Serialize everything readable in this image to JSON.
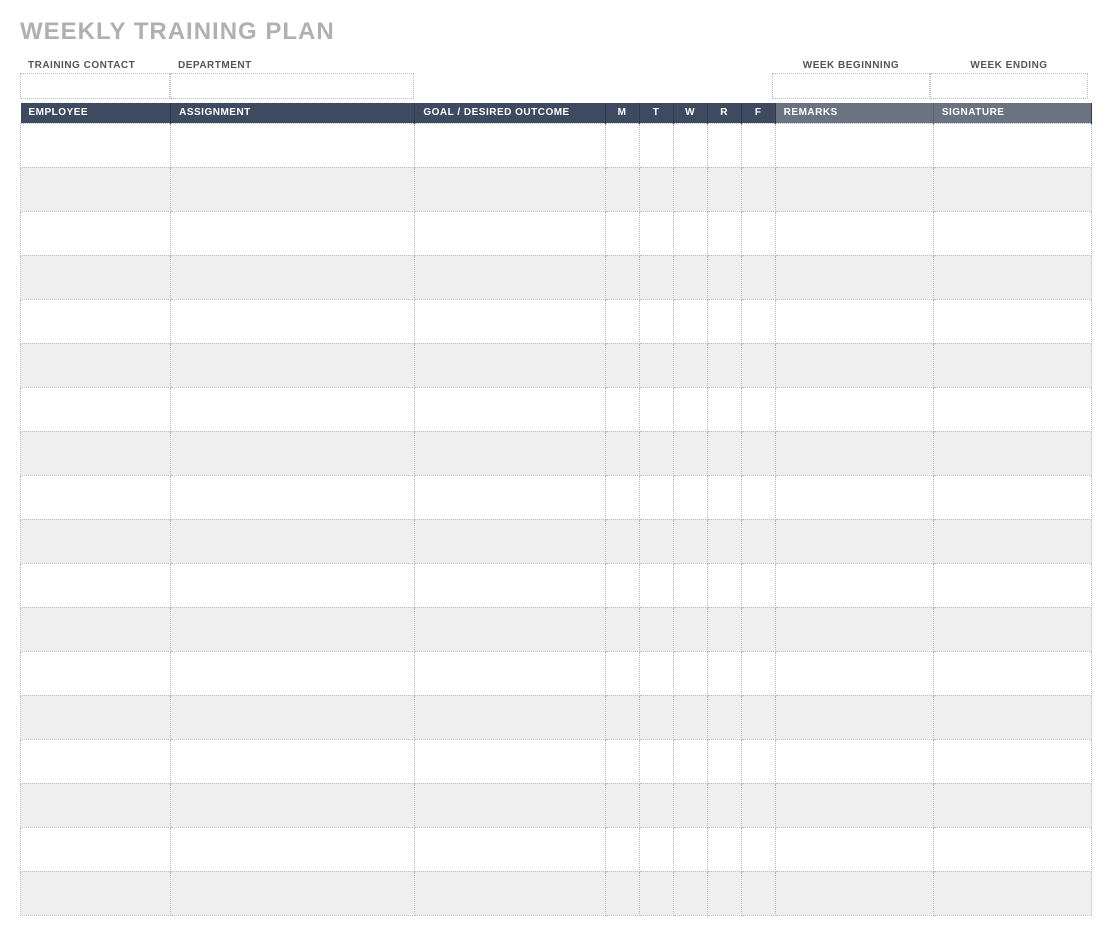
{
  "title": "WEEKLY TRAINING PLAN",
  "meta": {
    "training_contact_label": "TRAINING CONTACT",
    "department_label": "DEPARTMENT",
    "week_beginning_label": "WEEK BEGINNING",
    "week_ending_label": "WEEK ENDING",
    "training_contact": "",
    "department": "",
    "week_beginning": "",
    "week_ending": ""
  },
  "columns": {
    "employee": "EMPLOYEE",
    "assignment": "ASSIGNMENT",
    "goal": "GOAL / DESIRED OUTCOME",
    "m": "M",
    "t": "T",
    "w": "W",
    "r": "R",
    "f": "F",
    "remarks": "REMARKS",
    "signature": "SIGNATURE"
  },
  "rows": [
    {
      "employee": "",
      "assignment": "",
      "goal": "",
      "m": "",
      "t": "",
      "w": "",
      "r": "",
      "f": "",
      "remarks": "",
      "signature": ""
    },
    {
      "employee": "",
      "assignment": "",
      "goal": "",
      "m": "",
      "t": "",
      "w": "",
      "r": "",
      "f": "",
      "remarks": "",
      "signature": ""
    },
    {
      "employee": "",
      "assignment": "",
      "goal": "",
      "m": "",
      "t": "",
      "w": "",
      "r": "",
      "f": "",
      "remarks": "",
      "signature": ""
    },
    {
      "employee": "",
      "assignment": "",
      "goal": "",
      "m": "",
      "t": "",
      "w": "",
      "r": "",
      "f": "",
      "remarks": "",
      "signature": ""
    },
    {
      "employee": "",
      "assignment": "",
      "goal": "",
      "m": "",
      "t": "",
      "w": "",
      "r": "",
      "f": "",
      "remarks": "",
      "signature": ""
    },
    {
      "employee": "",
      "assignment": "",
      "goal": "",
      "m": "",
      "t": "",
      "w": "",
      "r": "",
      "f": "",
      "remarks": "",
      "signature": ""
    },
    {
      "employee": "",
      "assignment": "",
      "goal": "",
      "m": "",
      "t": "",
      "w": "",
      "r": "",
      "f": "",
      "remarks": "",
      "signature": ""
    },
    {
      "employee": "",
      "assignment": "",
      "goal": "",
      "m": "",
      "t": "",
      "w": "",
      "r": "",
      "f": "",
      "remarks": "",
      "signature": ""
    },
    {
      "employee": "",
      "assignment": "",
      "goal": "",
      "m": "",
      "t": "",
      "w": "",
      "r": "",
      "f": "",
      "remarks": "",
      "signature": ""
    },
    {
      "employee": "",
      "assignment": "",
      "goal": "",
      "m": "",
      "t": "",
      "w": "",
      "r": "",
      "f": "",
      "remarks": "",
      "signature": ""
    },
    {
      "employee": "",
      "assignment": "",
      "goal": "",
      "m": "",
      "t": "",
      "w": "",
      "r": "",
      "f": "",
      "remarks": "",
      "signature": ""
    },
    {
      "employee": "",
      "assignment": "",
      "goal": "",
      "m": "",
      "t": "",
      "w": "",
      "r": "",
      "f": "",
      "remarks": "",
      "signature": ""
    },
    {
      "employee": "",
      "assignment": "",
      "goal": "",
      "m": "",
      "t": "",
      "w": "",
      "r": "",
      "f": "",
      "remarks": "",
      "signature": ""
    },
    {
      "employee": "",
      "assignment": "",
      "goal": "",
      "m": "",
      "t": "",
      "w": "",
      "r": "",
      "f": "",
      "remarks": "",
      "signature": ""
    },
    {
      "employee": "",
      "assignment": "",
      "goal": "",
      "m": "",
      "t": "",
      "w": "",
      "r": "",
      "f": "",
      "remarks": "",
      "signature": ""
    },
    {
      "employee": "",
      "assignment": "",
      "goal": "",
      "m": "",
      "t": "",
      "w": "",
      "r": "",
      "f": "",
      "remarks": "",
      "signature": ""
    },
    {
      "employee": "",
      "assignment": "",
      "goal": "",
      "m": "",
      "t": "",
      "w": "",
      "r": "",
      "f": "",
      "remarks": "",
      "signature": ""
    },
    {
      "employee": "",
      "assignment": "",
      "goal": "",
      "m": "",
      "t": "",
      "w": "",
      "r": "",
      "f": "",
      "remarks": "",
      "signature": ""
    }
  ]
}
